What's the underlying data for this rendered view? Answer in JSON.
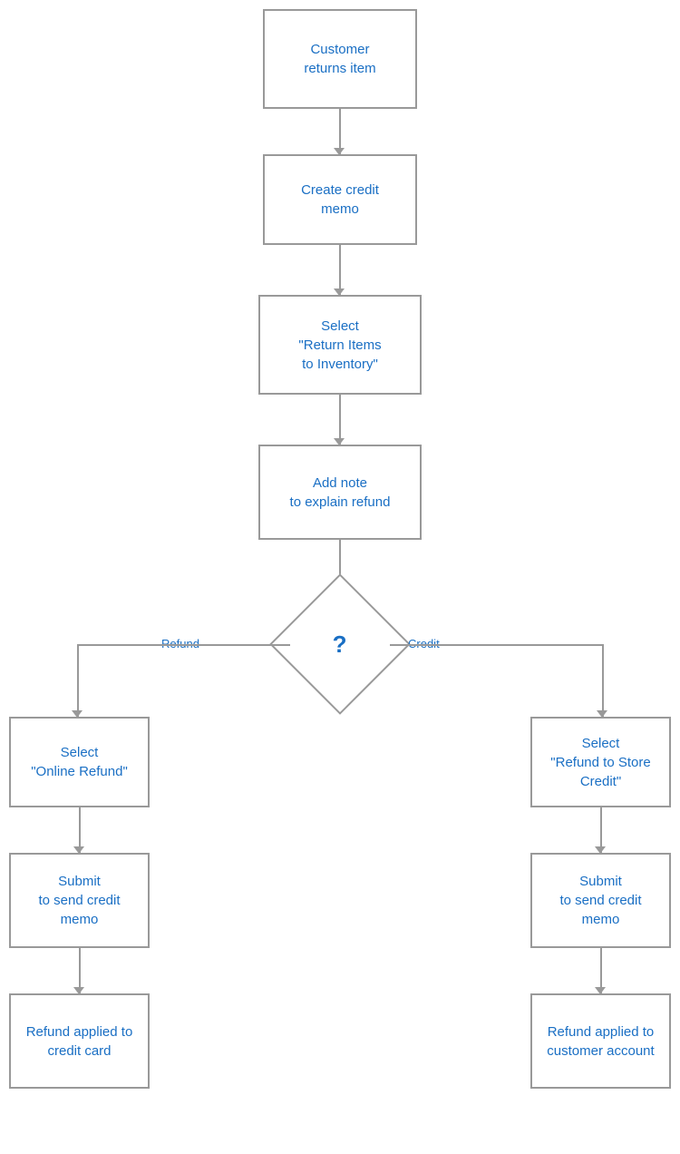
{
  "nodes": {
    "customer_returns": "Customer\nreturns item",
    "create_credit_memo": "Create credit\nmemo",
    "select_return_items": "Select\n\"Return Items\nto Inventory\"",
    "add_note": "Add note\nto explain refund",
    "decision_label": "?",
    "select_online_refund": "Select\n\"Online Refund\"",
    "select_store_credit": "Select\n\"Refund to Store\nCredit\"",
    "submit_left": "Submit\nto send credit\nmemo",
    "submit_right": "Submit\nto send credit\nmemo",
    "refund_credit_card": "Refund applied to\ncredit card",
    "refund_customer_account": "Refund applied to\ncustomer account"
  },
  "labels": {
    "refund": "Refund",
    "credit": "Credit"
  },
  "colors": {
    "text": "#1a6fc4",
    "border": "#999999",
    "background": "#ffffff"
  }
}
